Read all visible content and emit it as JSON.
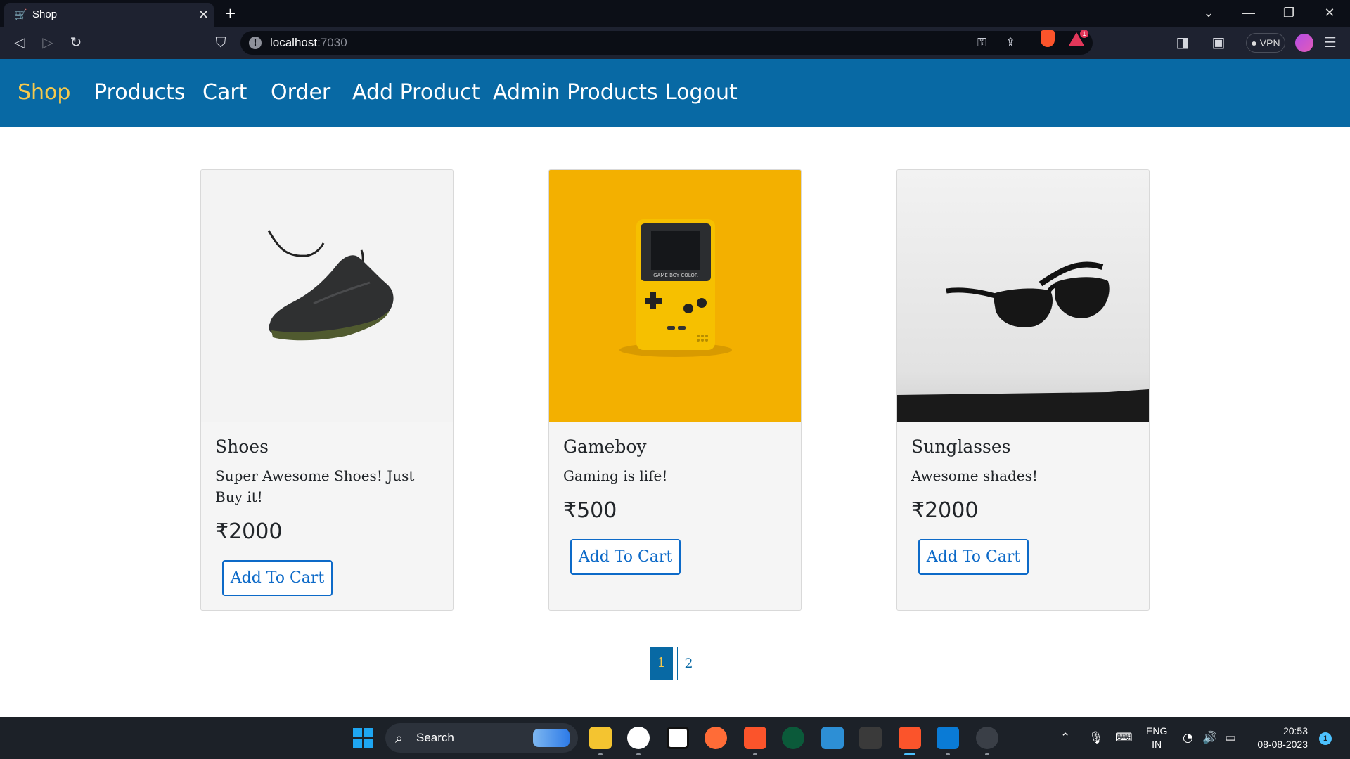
{
  "browser": {
    "tab_title": "Shop",
    "tab_icon": "cart-icon",
    "url_host": "localhost",
    "url_port": ":7030",
    "vpn_label": "VPN",
    "rewards_count": "1"
  },
  "nav": {
    "brand": "Shop",
    "items": [
      "Products",
      "Cart",
      "Order",
      "Add Product",
      "Admin Products",
      "Logout"
    ],
    "brand_color": "#f6c94c",
    "bar_color": "#0869a4"
  },
  "products": [
    {
      "title": "Shoes",
      "description": "Super Awesome Shoes! Just Buy it!",
      "price": "₹2000",
      "button": "Add To Cart",
      "image": "sneaker-image"
    },
    {
      "title": "Gameboy",
      "description": "Gaming is life!",
      "price": "₹500",
      "button": "Add To Cart",
      "image": "gameboy-image"
    },
    {
      "title": "Sunglasses",
      "description": "Awesome shades!",
      "price": "₹2000",
      "button": "Add To Cart",
      "image": "sunglasses-image"
    }
  ],
  "gameboy_label": "GAME BOY COLOR",
  "pagination": {
    "pages": [
      "1",
      "2"
    ],
    "current": "1"
  },
  "taskbar": {
    "search_label": "Search",
    "language": "ENG",
    "region": "IN",
    "time": "20:53",
    "date": "08-08-2023",
    "notification_count": "1"
  }
}
